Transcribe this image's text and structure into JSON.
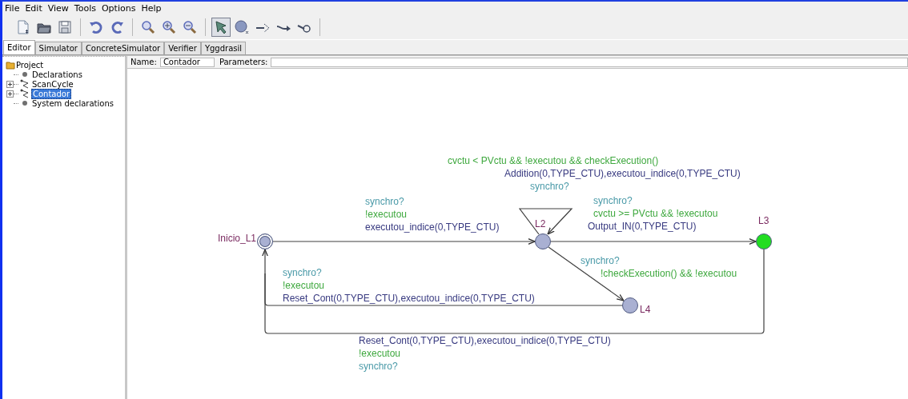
{
  "menu": [
    "File",
    "Edit",
    "View",
    "Tools",
    "Options",
    "Help"
  ],
  "toolbar": [
    {
      "kind": "new",
      "selected": false
    },
    {
      "kind": "open",
      "selected": false
    },
    {
      "kind": "save",
      "selected": false
    },
    {
      "kind": "separator"
    },
    {
      "kind": "undo",
      "selected": false
    },
    {
      "kind": "redo",
      "selected": false
    },
    {
      "kind": "separator"
    },
    {
      "kind": "zoom-fit",
      "selected": false
    },
    {
      "kind": "zoom-in",
      "selected": false
    },
    {
      "kind": "zoom-out",
      "selected": false
    },
    {
      "kind": "separator"
    },
    {
      "kind": "select",
      "selected": true
    },
    {
      "kind": "location",
      "selected": false
    },
    {
      "kind": "edge",
      "selected": false
    },
    {
      "kind": "nail",
      "selected": false
    },
    {
      "kind": "pin",
      "selected": false
    },
    {
      "kind": "separator"
    }
  ],
  "tabs": [
    {
      "label": "Editor",
      "selected": true
    },
    {
      "label": "Simulator",
      "selected": false
    },
    {
      "label": "ConcreteSimulator",
      "selected": false
    },
    {
      "label": "Verifier",
      "selected": false
    },
    {
      "label": "Yggdrasil",
      "selected": false
    }
  ],
  "tree": {
    "label": "Project",
    "kind": "folder",
    "children": [
      {
        "label": "Declarations",
        "kind": "declarations",
        "selected": false
      },
      {
        "label": "ScanCycle",
        "kind": "template",
        "expanded": false,
        "selected": false
      },
      {
        "label": "Contador",
        "kind": "template",
        "expanded": false,
        "selected": true
      },
      {
        "label": "System declarations",
        "kind": "declarations",
        "selected": false
      }
    ]
  },
  "template": {
    "name_label": "Name:",
    "name": "Contador",
    "parameters_label": "Parameters:"
  },
  "locations": [
    {
      "name": "Inicio_L1",
      "kind": "initial",
      "color": "#a9b0d2"
    },
    {
      "name": "L2",
      "kind": "normal",
      "color": "#a9b0d2"
    },
    {
      "name": "L3",
      "kind": "normal",
      "color": "#22dd22"
    },
    {
      "name": "L4",
      "kind": "normal",
      "color": "#a9b0d2"
    }
  ],
  "edges": [
    {
      "labels": [
        {
          "kind": "sync",
          "text": "synchro?"
        },
        {
          "kind": "guard",
          "text": "!executou"
        },
        {
          "kind": "update",
          "text": "executou_indice(0,TYPE_CTU)"
        }
      ]
    },
    {
      "labels": [
        {
          "kind": "guard",
          "text": "cvctu < PVctu && !executou && checkExecution()"
        },
        {
          "kind": "update",
          "text": "Addition(0,TYPE_CTU),executou_indice(0,TYPE_CTU)"
        },
        {
          "kind": "sync",
          "text": "synchro?"
        }
      ]
    },
    {
      "labels": [
        {
          "kind": "sync",
          "text": "synchro?"
        },
        {
          "kind": "guard",
          "text": "cvctu >= PVctu && !executou"
        },
        {
          "kind": "update",
          "text": "Output_IN(0,TYPE_CTU)"
        }
      ]
    },
    {
      "labels": [
        {
          "kind": "sync",
          "text": "synchro?"
        },
        {
          "kind": "guard",
          "text": "!checkExecution() && !executou"
        }
      ]
    },
    {
      "labels": [
        {
          "kind": "sync",
          "text": "synchro?"
        },
        {
          "kind": "guard",
          "text": "!executou"
        },
        {
          "kind": "update",
          "text": "Reset_Cont(0,TYPE_CTU),executou_indice(0,TYPE_CTU)"
        }
      ]
    },
    {
      "labels": [
        {
          "kind": "update",
          "text": "Reset_Cont(0,TYPE_CTU),executou_indice(0,TYPE_CTU)"
        },
        {
          "kind": "guard",
          "text": "!executou"
        },
        {
          "kind": "sync",
          "text": "synchro?"
        }
      ]
    }
  ]
}
